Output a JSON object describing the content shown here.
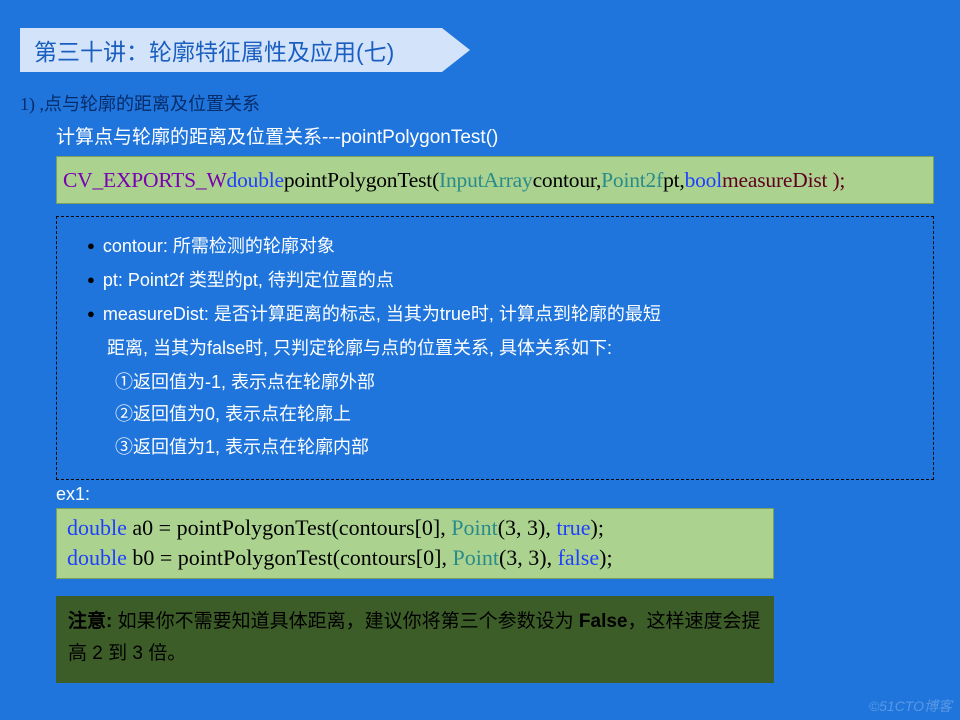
{
  "title": "第三十讲：轮廓特征属性及应用(七)",
  "section": "1) ,点与轮廓的距离及位置关系",
  "desc": "计算点与轮廓的距离及位置关系---pointPolygonTest()",
  "api": {
    "t1": "CV_EXPORTS_W",
    "t2": " double ",
    "t3": "pointPolygonTest( ",
    "t4": "InputArray",
    "t5": " contour, ",
    "t6": "Point2f",
    "t7": " pt, ",
    "t8": "bool ",
    "t9": "measureDist );"
  },
  "params": {
    "p1": "contour: 所需检测的轮廓对象",
    "p2": "pt: Point2f 类型的pt, 待判定位置的点",
    "p3a": "measureDist: 是否计算距离的标志, 当其为true时, 计算点到轮廓的最短",
    "p3b": "距离, 当其为false时, 只判定轮廓与点的位置关系, 具体关系如下:",
    "s1": "①返回值为-1, 表示点在轮廓外部",
    "s2": "②返回值为0, 表示点在轮廓上",
    "s3": "③返回值为1, 表示点在轮廓内部"
  },
  "ex_label": "ex1:",
  "code": {
    "l1a": "double",
    "l1b": " a0 = pointPolygonTest(contours[0], ",
    "l1c": "Point",
    "l1d": "(3, 3), ",
    "l1e": "true",
    "l1f": ");",
    "l2a": "double",
    "l2b": " b0 = pointPolygonTest(contours[0], ",
    "l2c": "Point",
    "l2d": "(3, 3), ",
    "l2e": "false",
    "l2f": ");"
  },
  "note": {
    "label": "注意:",
    "t1": " 如果你不需要知道具体距离，建议你将第三个参数设为 ",
    "t2": "False",
    "t3": "，这样速度会提高 2 到 3 倍。"
  },
  "watermark": "©51CTO博客"
}
